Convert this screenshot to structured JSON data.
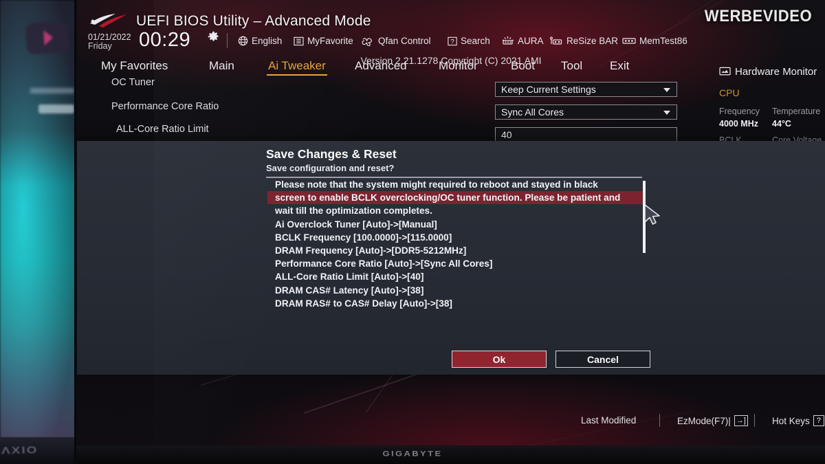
{
  "watermark": "WERBEVIDEO",
  "header": {
    "title": "UEFI BIOS Utility – Advanced Mode",
    "date": "01/21/2022",
    "weekday": "Friday",
    "time": "00:29",
    "gear_icon": "gear-icon",
    "tools": [
      {
        "label": "English",
        "icon": "globe-icon"
      },
      {
        "label": "MyFavorite",
        "icon": "star-list-icon"
      },
      {
        "label": "Qfan Control",
        "icon": "fan-icon"
      },
      {
        "label": "Search",
        "icon": "question-box-icon"
      },
      {
        "label": "AURA",
        "icon": "aura-light-icon"
      },
      {
        "label": "ReSize BAR",
        "icon": "resize-bar-icon"
      },
      {
        "label": "MemTest86",
        "icon": "memory-icon"
      }
    ]
  },
  "tabs": [
    {
      "label": "My Favorites",
      "selected": false
    },
    {
      "label": "Main",
      "selected": false
    },
    {
      "label": "Ai Tweaker",
      "selected": true
    },
    {
      "label": "Advanced",
      "selected": false
    },
    {
      "label": "Monitor",
      "selected": false
    },
    {
      "label": "Boot",
      "selected": false
    },
    {
      "label": "Tool",
      "selected": false
    },
    {
      "label": "Exit",
      "selected": false
    }
  ],
  "settings_rows": [
    {
      "label": "OC Tuner",
      "value": "Keep Current Settings",
      "type": "dropdown"
    },
    {
      "label": "Performance Core Ratio",
      "value": "Sync All Cores",
      "type": "dropdown"
    },
    {
      "label": "ALL-Core Ratio Limit",
      "value": "40",
      "type": "text"
    }
  ],
  "hardware_monitor": {
    "title": "Hardware Monitor",
    "icon": "monitor-icon",
    "section": "CPU",
    "metrics": [
      {
        "key": "Frequency",
        "value": "4000 MHz"
      },
      {
        "key": "Temperature",
        "value": "44°C"
      }
    ],
    "next_keys": [
      "BCLK",
      "Core Voltage"
    ]
  },
  "dialog": {
    "title": "Save Changes & Reset",
    "subtitle": "Save configuration and reset?",
    "lines": [
      {
        "text": "Please note that the system might required to reboot and stayed in black",
        "highlighted": false
      },
      {
        "text": "screen to enable BCLK overclocking/OC tuner function. Please be patient and",
        "highlighted": true
      },
      {
        "text": "wait till the optimization completes.",
        "highlighted": false
      },
      {
        "text": "Ai Overclock Tuner [Auto]->[Manual]",
        "highlighted": false
      },
      {
        "text": "BCLK Frequency [100.0000]->[115.0000]",
        "highlighted": false
      },
      {
        "text": "DRAM Frequency [Auto]->[DDR5-5212MHz]",
        "highlighted": false
      },
      {
        "text": "Performance Core Ratio [Auto]->[Sync All Cores]",
        "highlighted": false
      },
      {
        "text": "ALL-Core Ratio Limit [Auto]->[40]",
        "highlighted": false
      },
      {
        "text": "DRAM CAS# Latency [Auto]->[38]",
        "highlighted": false
      },
      {
        "text": "DRAM RAS# to CAS# Delay [Auto]->[38]",
        "highlighted": false
      }
    ],
    "ok_label": "Ok",
    "cancel_label": "Cancel",
    "accent_ok": "#90242f",
    "highlight_color": "#7b2430"
  },
  "footer": {
    "version": "Version 2.21.1278 Copyright (C) 2021 AMI",
    "last_modified": "Last Modified",
    "ezmode": "EzMode(F7)|",
    "ezmode_key": "→]",
    "hotkeys": "Hot Keys",
    "hotkeys_key": "?"
  },
  "monitor_brand": "GIGABYTE",
  "keyboard_brand": "ΛXIO",
  "colors": {
    "accent_gold": "#e8a33a",
    "dialog_bg": "#2b3039",
    "ok_red": "#90242f",
    "highlight_red": "#7b2430"
  }
}
